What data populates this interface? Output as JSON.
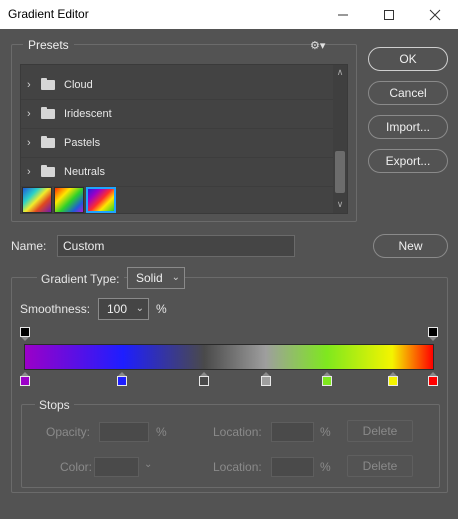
{
  "window": {
    "title": "Gradient Editor",
    "minimize_glyph": "—",
    "maximize_glyph": "☐",
    "close_glyph": "✕"
  },
  "presets": {
    "label": "Presets",
    "gear_glyph": "⚙▾",
    "items": [
      {
        "label": "Cloud",
        "icon": "folder-icon"
      },
      {
        "label": "Iridescent",
        "icon": "folder-icon"
      },
      {
        "label": "Pastels",
        "icon": "folder-icon"
      },
      {
        "label": "Neutrals",
        "icon": "folder-icon"
      }
    ],
    "chevron_glyph": "›",
    "scroll_up_glyph": "∧",
    "scroll_down_glyph": "∨"
  },
  "buttons": {
    "ok": "OK",
    "cancel": "Cancel",
    "import": "Import...",
    "export": "Export...",
    "new": "New"
  },
  "name": {
    "label": "Name:",
    "value": "Custom"
  },
  "gradient": {
    "type_label": "Gradient Type:",
    "type_value": "Solid",
    "smoothness_label": "Smoothness:",
    "smoothness_value": "100",
    "smoothness_unit": "%",
    "dropdown_glyph": "⌄",
    "opacity_stops": [
      {
        "location": 0,
        "color": "#000000"
      },
      {
        "location": 100,
        "color": "#000000"
      }
    ],
    "color_stops": [
      {
        "location": 0,
        "color": "#9b00c8"
      },
      {
        "location": 24,
        "color": "#1e1eff"
      },
      {
        "location": 44,
        "color": "#4a4a4a"
      },
      {
        "location": 59,
        "color": "#9e9e9e"
      },
      {
        "location": 74,
        "color": "#7fe81e"
      },
      {
        "location": 90,
        "color": "#f4f400"
      },
      {
        "location": 100,
        "color": "#ff0000"
      }
    ]
  },
  "stops": {
    "label": "Stops",
    "opacity_label": "Opacity:",
    "opacity_unit": "%",
    "location_label": "Location:",
    "location_unit": "%",
    "color_label": "Color:",
    "delete_label": "Delete"
  }
}
